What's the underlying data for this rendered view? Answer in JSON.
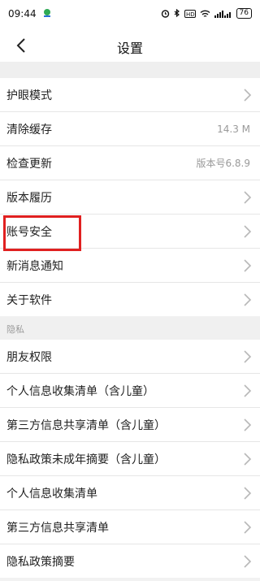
{
  "status_bar": {
    "time": "09:44",
    "icons": [
      "alarm-icon",
      "bluetooth-icon",
      "hd-icon",
      "wifi-icon",
      "signal-icon"
    ],
    "battery": "76"
  },
  "nav": {
    "title": "设置",
    "back_icon": "chevron-left-icon"
  },
  "general_items": [
    {
      "label": "护眼模式",
      "value": "",
      "chevron": true
    },
    {
      "label": "清除缓存",
      "value": "14.3 M",
      "chevron": false
    },
    {
      "label": "检查更新",
      "value": "版本号6.8.9",
      "chevron": false
    },
    {
      "label": "版本履历",
      "value": "",
      "chevron": true
    },
    {
      "label": "账号安全",
      "value": "",
      "chevron": true
    },
    {
      "label": "新消息通知",
      "value": "",
      "chevron": true
    },
    {
      "label": "关于软件",
      "value": "",
      "chevron": true
    }
  ],
  "privacy_section": {
    "header": "隐私",
    "items": [
      {
        "label": "朋友权限"
      },
      {
        "label": "个人信息收集清单（含儿童）"
      },
      {
        "label": "第三方信息共享清单（含儿童）"
      },
      {
        "label": "隐私政策未成年摘要（含儿童）"
      },
      {
        "label": "个人信息收集清单"
      },
      {
        "label": "第三方信息共享清单"
      },
      {
        "label": "隐私政策摘要"
      }
    ]
  },
  "annotation": {
    "highlighted_item": "账号安全",
    "color": "#e02020"
  }
}
